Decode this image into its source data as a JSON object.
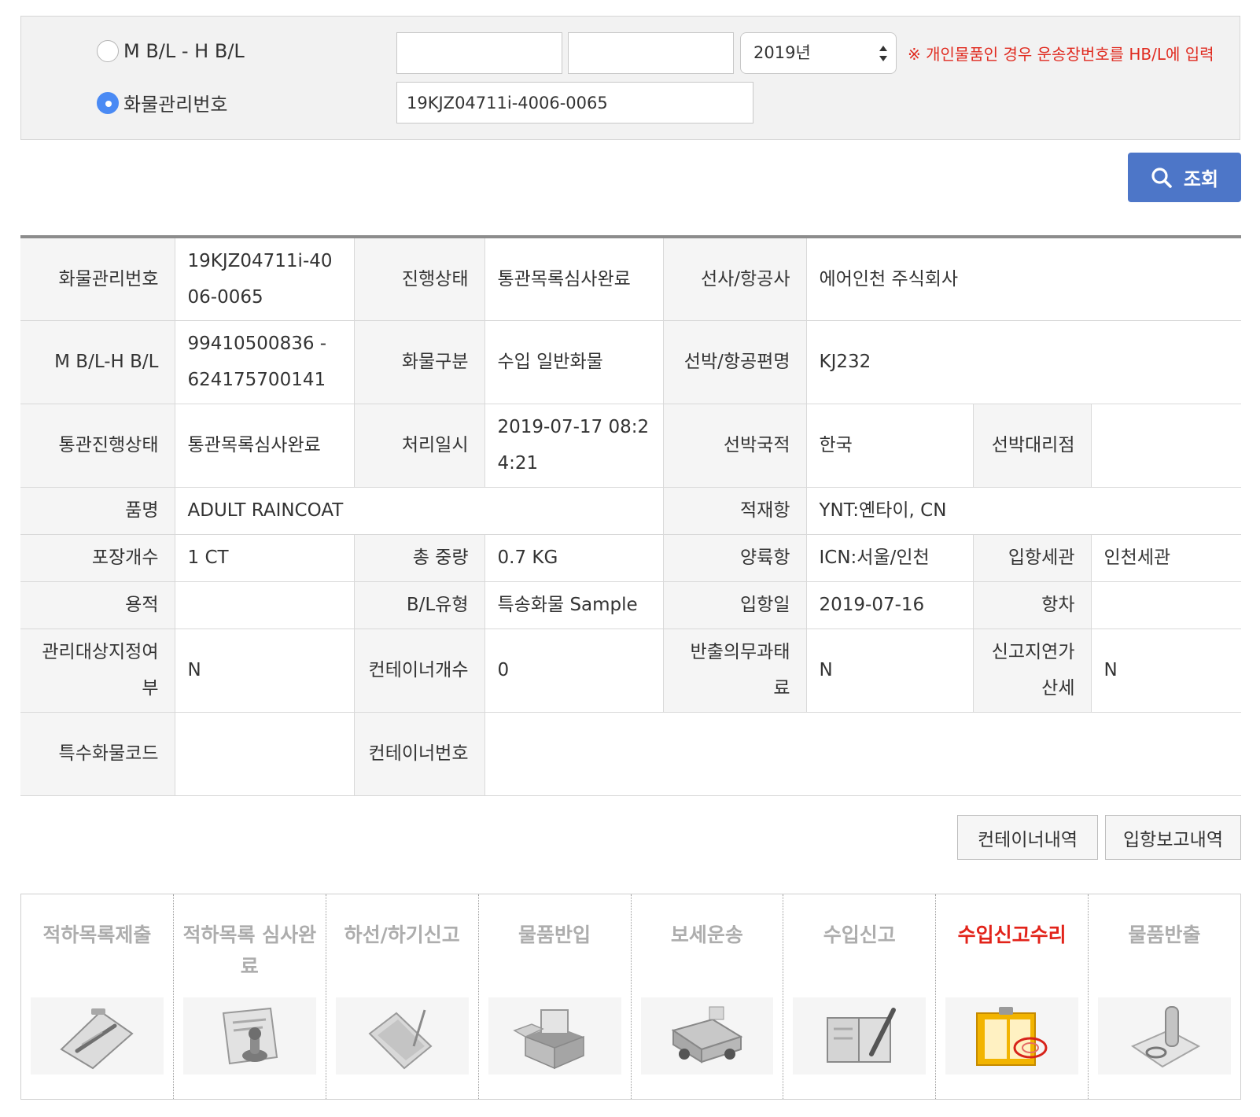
{
  "search": {
    "option_bl_label": "M B/L - H B/L",
    "option_cargo_label": "화물관리번호",
    "selected_option": "cargo",
    "mbl_value": "",
    "hbl_value": "",
    "year_selected": "2019년",
    "notice": "※ 개인물품인 경우 운송장번호를 HB/L에 입력",
    "cargo_value": "19KJZ04711i-4006-0065",
    "search_button_label": "조회"
  },
  "info": {
    "cargo_no_label": "화물관리번호",
    "cargo_no": "19KJZ04711i-4006-0065",
    "progress_label": "진행상태",
    "progress": "통관목록심사완료",
    "carrier_label": "선사/항공사",
    "carrier": "에어인천 주식회사",
    "bl_label": "M B/L-H B/L",
    "bl": "99410500836 - 624175700141",
    "cargo_type_label": "화물구분",
    "cargo_type": "수입 일반화물",
    "vessel_label": "선박/항공편명",
    "vessel": "KJ232",
    "customs_status_label": "통관진행상태",
    "customs_status": "통관목록심사완료",
    "processed_at_label": "처리일시",
    "processed_at": "2019-07-17 08:24:21",
    "vessel_nation_label": "선박국적",
    "vessel_nation": "한국",
    "vessel_agent_label": "선박대리점",
    "vessel_agent": "",
    "item_label": "품명",
    "item": "ADULT RAINCOAT",
    "loading_port_label": "적재항",
    "loading_port": "YNT:옌타이, CN",
    "packages_label": "포장개수",
    "packages": "1 CT",
    "total_weight_label": "총 중량",
    "total_weight": "0.7 KG",
    "unloading_port_label": "양륙항",
    "unloading_port": "ICN:서울/인천",
    "entry_customs_label": "입항세관",
    "entry_customs": "인천세관",
    "volume_label": "용적",
    "volume": "",
    "bl_type_label": "B/L유형",
    "bl_type": "특송화물 Sample",
    "arrival_date_label": "입항일",
    "arrival_date": "2019-07-16",
    "voyage_label": "항차",
    "voyage": "",
    "managed_label": "관리대상지정여부",
    "managed": "N",
    "container_count_label": "컨테이너개수",
    "container_count": "0",
    "export_duty_label": "반출의무과태료",
    "export_duty": "N",
    "late_fee_label": "신고지연가산세",
    "late_fee": "N",
    "special_code_label": "특수화물코드",
    "special_code": "",
    "container_no_label": "컨테이너번호",
    "container_no": ""
  },
  "actions": {
    "container_history": "컨테이너내역",
    "arrival_report": "입항보고내역"
  },
  "steps": [
    {
      "label": "적하목록제출",
      "icon": "clipboard-pen-icon",
      "active": false
    },
    {
      "label": "적하목록 심사완료",
      "icon": "document-stamp-icon",
      "active": false
    },
    {
      "label": "하선/하기신고",
      "icon": "notebook-pen-icon",
      "active": false
    },
    {
      "label": "물품반입",
      "icon": "open-box-icon",
      "active": false
    },
    {
      "label": "보세운송",
      "icon": "truck-icon",
      "active": false
    },
    {
      "label": "수입신고",
      "icon": "open-book-pen-icon",
      "active": false
    },
    {
      "label": "수입신고수리",
      "icon": "approved-document-icon",
      "active": true
    },
    {
      "label": "물품반출",
      "icon": "stamp-paper-icon",
      "active": false
    }
  ],
  "colors": {
    "accent_blue": "#4d76c8",
    "radio_blue": "#4a8af4",
    "notice_red": "#e02b20",
    "active_step_red": "#e2231a",
    "inactive_step_gray": "#adadad"
  }
}
